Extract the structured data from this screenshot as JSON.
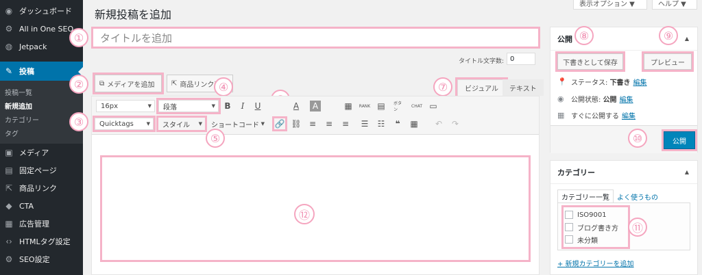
{
  "sidebar": {
    "items_top": [
      {
        "label": "ダッシュボード",
        "icon": "dashboard-icon"
      },
      {
        "label": "All in One SEO",
        "icon": "gear-icon"
      },
      {
        "label": "Jetpack",
        "icon": "jetpack-icon"
      }
    ],
    "active": {
      "label": "投稿",
      "icon": "pin-icon"
    },
    "sub": [
      "投稿一覧",
      "新規追加",
      "カテゴリー",
      "タグ"
    ],
    "items_bottom": [
      {
        "label": "メディア",
        "icon": "media-icon"
      },
      {
        "label": "固定ページ",
        "icon": "page-icon"
      },
      {
        "label": "商品リンク",
        "icon": "link-icon"
      },
      {
        "label": "CTA",
        "icon": "diamond-icon"
      },
      {
        "label": "広告管理",
        "icon": "ad-icon"
      },
      {
        "label": "HTMLタグ設定",
        "icon": "code-icon"
      },
      {
        "label": "SEO設定",
        "icon": "gear-icon"
      }
    ]
  },
  "header": {
    "title": "新規投稿を追加",
    "display_options": "表示オプション ▼",
    "help": "ヘルプ ▼"
  },
  "editor": {
    "title_placeholder": "タイトルを追加",
    "char_count_label": "タイトル文字数:",
    "char_count_value": "0",
    "add_media": "メディアを追加",
    "add_product_link": "商品リンク追加",
    "tab_visual": "ビジュアル",
    "tab_text": "テキスト",
    "font_size": "16px",
    "paragraph": "段落",
    "quicktags": "Quicktags",
    "style": "スタイル",
    "shortcode": "ショートコード"
  },
  "numbers": [
    "①",
    "②",
    "③",
    "④",
    "⑤",
    "⑥",
    "⑦",
    "⑧",
    "⑨",
    "⑩",
    "⑪",
    "⑫"
  ],
  "publish": {
    "title": "公開",
    "save_draft": "下書きとして保存",
    "preview": "プレビュー",
    "status_label": "ステータス:",
    "status_value": "下書き",
    "visibility_label": "公開状態:",
    "visibility_value": "公開",
    "schedule_label": "すぐに公開する",
    "edit": "編集",
    "publish_button": "公開"
  },
  "category": {
    "title": "カテゴリー",
    "tab_all": "カテゴリー一覧",
    "tab_popular": "よく使うもの",
    "items": [
      "ISO9001",
      "ブログ書き方",
      "未分類"
    ],
    "add_new": "+ 新規カテゴリーを追加"
  },
  "colors": {
    "accent": "#0073aa",
    "annotation": "#f5b3c8",
    "publish": "#0085ba"
  }
}
